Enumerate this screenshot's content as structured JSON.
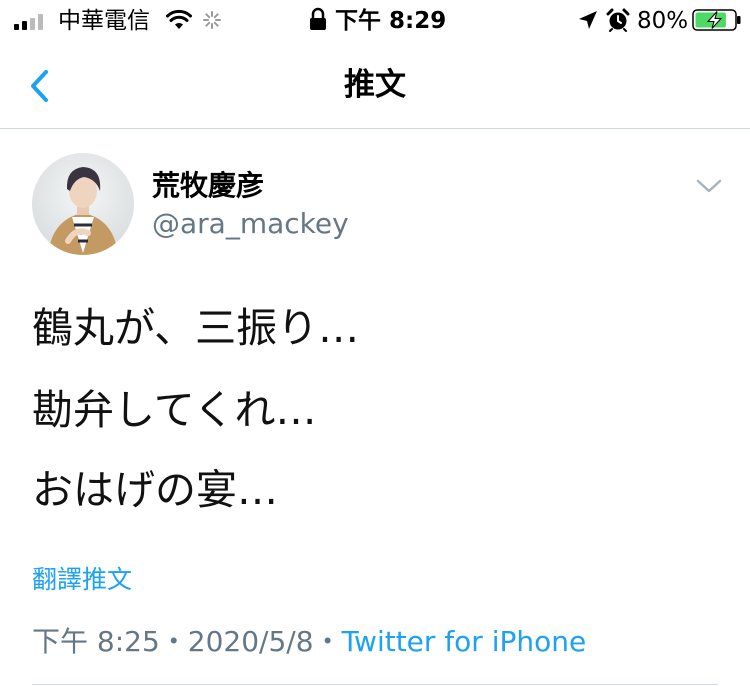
{
  "status_bar": {
    "carrier": "中華電信",
    "time": "下午 8:29",
    "battery_percent": "80%",
    "battery_level": 0.8,
    "icons": [
      "signal-icon",
      "wifi-icon",
      "loading-spinner-icon",
      "lock-icon",
      "location-arrow-icon",
      "alarm-icon",
      "battery-charging-icon"
    ]
  },
  "nav": {
    "title": "推文",
    "back_icon": "chevron-left-icon"
  },
  "tweet": {
    "author_name": "荒牧慶彦",
    "author_handle": "@ara_mackey",
    "menu_icon": "chevron-down-icon",
    "lines": [
      "鶴丸が、三振り…",
      "勘弁してくれ…",
      "おはげの宴…"
    ],
    "translate_label": "翻譯推文",
    "time": "下午 8:25",
    "date": "2020/5/8",
    "separator": "・",
    "source": "Twitter for iPhone"
  },
  "colors": {
    "accent": "#1da1f2",
    "secondary_text": "#657786",
    "divider": "#cfd9de",
    "battery_green": "#4cd964"
  }
}
